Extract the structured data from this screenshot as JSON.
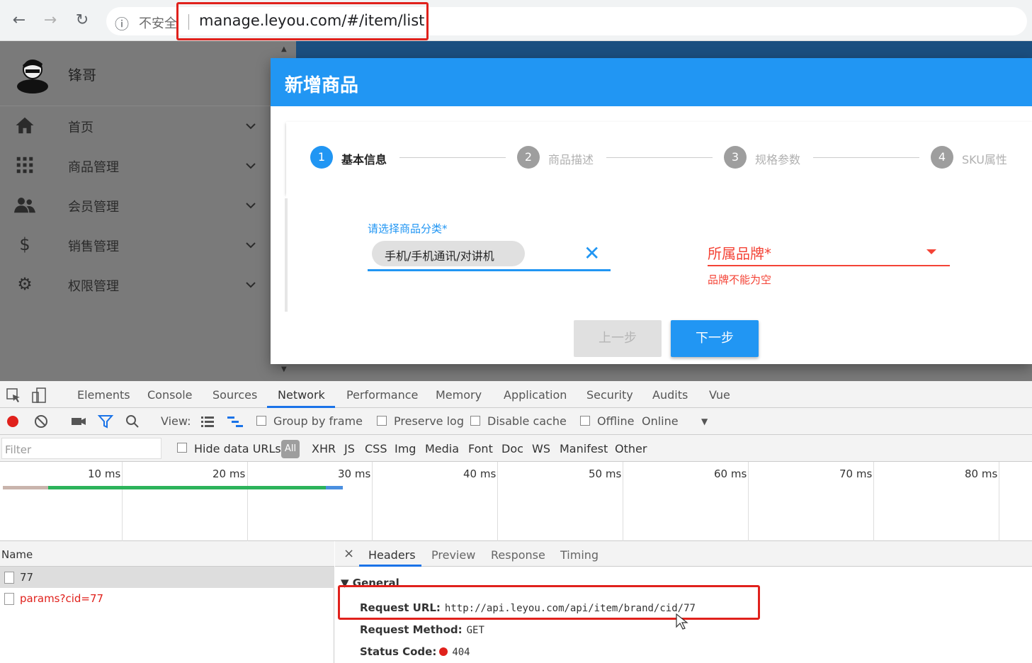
{
  "browser": {
    "insecure_label": "不安全",
    "url": "manage.leyou.com/#/item/list"
  },
  "sidebar": {
    "user_name": "锋哥",
    "items": [
      {
        "label": "首页",
        "icon": "home-icon"
      },
      {
        "label": "商品管理",
        "icon": "apps-grid-icon"
      },
      {
        "label": "会员管理",
        "icon": "people-icon"
      },
      {
        "label": "销售管理",
        "icon": "dollar-icon"
      },
      {
        "label": "权限管理",
        "icon": "gear-icon"
      }
    ]
  },
  "dialog": {
    "title": "新增商品",
    "steps": [
      {
        "number": "1",
        "label": "基本信息",
        "active": true
      },
      {
        "number": "2",
        "label": "商品描述",
        "active": false
      },
      {
        "number": "3",
        "label": "规格参数",
        "active": false
      },
      {
        "number": "4",
        "label": "SKU属性",
        "active": false
      }
    ],
    "category_label": "请选择商品分类*",
    "category_value": "手机/手机通讯/对讲机",
    "brand_label": "所属品牌*",
    "brand_error": "品牌不能为空",
    "prev_button": "上一步",
    "next_button": "下一步",
    "colors": {
      "primary": "#2196f3",
      "error": "#f44336"
    }
  },
  "devtools": {
    "tabs": [
      "Elements",
      "Console",
      "Sources",
      "Network",
      "Performance",
      "Memory",
      "Application",
      "Security",
      "Audits",
      "Vue"
    ],
    "active_tab": "Network",
    "toolbar": {
      "view_label": "View:",
      "group_by_frame": "Group by frame",
      "preserve_log": "Preserve log",
      "disable_cache": "Disable cache",
      "offline": "Offline",
      "throttle": "Online"
    },
    "filter": {
      "placeholder": "Filter",
      "hide_data_urls": "Hide data URLs",
      "all": "All",
      "types": [
        "XHR",
        "JS",
        "CSS",
        "Img",
        "Media",
        "Font",
        "Doc",
        "WS",
        "Manifest",
        "Other"
      ]
    },
    "timeline": {
      "ticks": [
        "10 ms",
        "20 ms",
        "30 ms",
        "40 ms",
        "50 ms",
        "60 ms",
        "70 ms",
        "80 ms"
      ]
    },
    "requests": {
      "column": "Name",
      "rows": [
        {
          "name": "77",
          "error": false
        },
        {
          "name": "params?cid=77",
          "error": true
        }
      ]
    },
    "details": {
      "tabs": [
        "Headers",
        "Preview",
        "Response",
        "Timing"
      ],
      "section": "▼ General",
      "request_url_key": "Request URL:",
      "request_url": "http://api.leyou.com/api/item/brand/cid/77",
      "method_key": "Request Method:",
      "method": "GET",
      "status_key": "Status Code:",
      "status": "404"
    }
  }
}
